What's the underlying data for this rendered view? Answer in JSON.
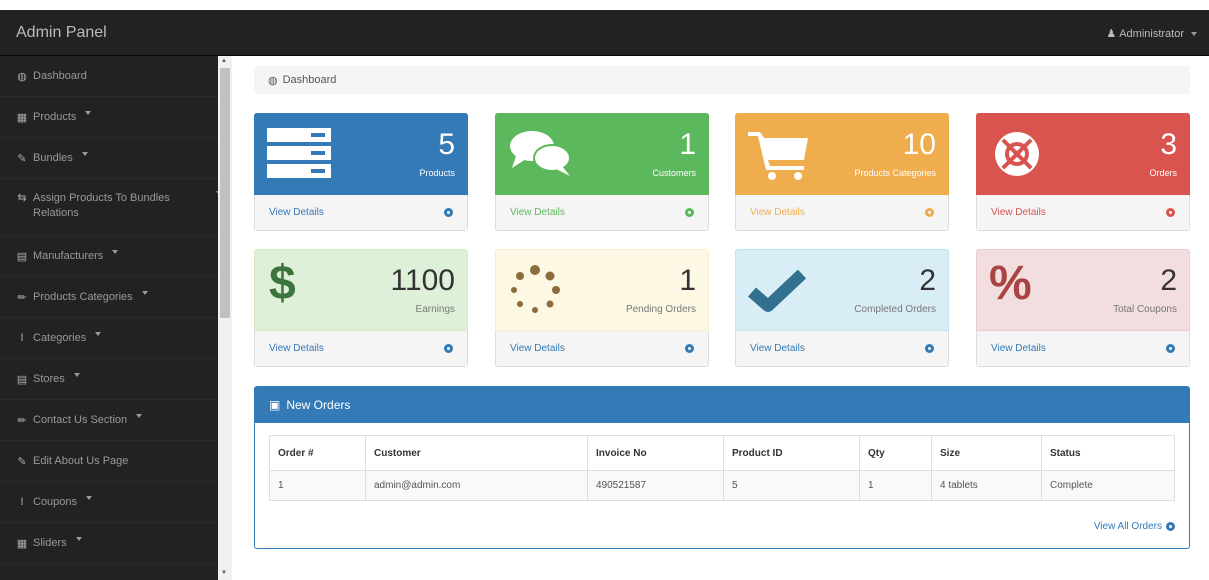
{
  "navbar": {
    "brand": "Admin Panel",
    "user": "Administrator"
  },
  "sidebar": {
    "items": [
      {
        "icon": "dashboard-icon",
        "glyph": "◍",
        "label": "Dashboard",
        "caret": false
      },
      {
        "icon": "table-icon",
        "glyph": "▦",
        "label": "Products",
        "caret": true
      },
      {
        "icon": "edit-icon",
        "glyph": "✎",
        "label": "Bundles",
        "caret": true
      },
      {
        "icon": "arrows-icon",
        "glyph": "⇆",
        "label": "Assign Products To Bundles Relations",
        "caret": true
      },
      {
        "icon": "building-icon",
        "glyph": "▤",
        "label": "Manufacturers",
        "caret": true
      },
      {
        "icon": "pencil-icon",
        "glyph": "✏",
        "label": "Products Categories",
        "caret": true
      },
      {
        "icon": "cursor-icon",
        "glyph": "I",
        "label": "Categories",
        "caret": true
      },
      {
        "icon": "store-icon",
        "glyph": "▤",
        "label": "Stores",
        "caret": true
      },
      {
        "icon": "pencil-icon",
        "glyph": "✏",
        "label": "Contact Us Section",
        "caret": true
      },
      {
        "icon": "edit-icon",
        "glyph": "✎",
        "label": "Edit About Us Page",
        "caret": false
      },
      {
        "icon": "cursor-icon",
        "glyph": "I",
        "label": "Coupons",
        "caret": true
      },
      {
        "icon": "table-icon",
        "glyph": "▦",
        "label": "Sliders",
        "caret": true
      }
    ]
  },
  "breadcrumb": "Dashboard",
  "cards": [
    {
      "key": "products",
      "value": "5",
      "label": "Products",
      "link": "View Details",
      "color": "#337ab7"
    },
    {
      "key": "customers",
      "value": "1",
      "label": "Customers",
      "link": "View Details",
      "color": "#5cb85c"
    },
    {
      "key": "products-categories",
      "value": "10",
      "label": "Products Categories",
      "link": "View Details",
      "color": "#f0ad4e"
    },
    {
      "key": "orders",
      "value": "3",
      "label": "Orders",
      "link": "View Details",
      "color": "#d9534f"
    },
    {
      "key": "earnings",
      "value": "1100",
      "label": "Earnings",
      "link": "View Details",
      "color": "#3c763d"
    },
    {
      "key": "pending-orders",
      "value": "1",
      "label": "Pending Orders",
      "link": "View Details",
      "color": "#8a6d3b"
    },
    {
      "key": "completed-orders",
      "value": "2",
      "label": "Completed Orders",
      "link": "View Details",
      "color": "#31708f"
    },
    {
      "key": "total-coupons",
      "value": "2",
      "label": "Total Coupons",
      "link": "View Details",
      "color": "#a94442"
    }
  ],
  "orders_panel": {
    "title": "New Orders",
    "columns": [
      "Order #",
      "Customer",
      "Invoice No",
      "Product ID",
      "Qty",
      "Size",
      "Status"
    ],
    "rows": [
      [
        "1",
        "admin@admin.com",
        "490521587",
        "5",
        "1",
        "4 tablets",
        "Complete"
      ]
    ],
    "view_all": "View All Orders"
  }
}
